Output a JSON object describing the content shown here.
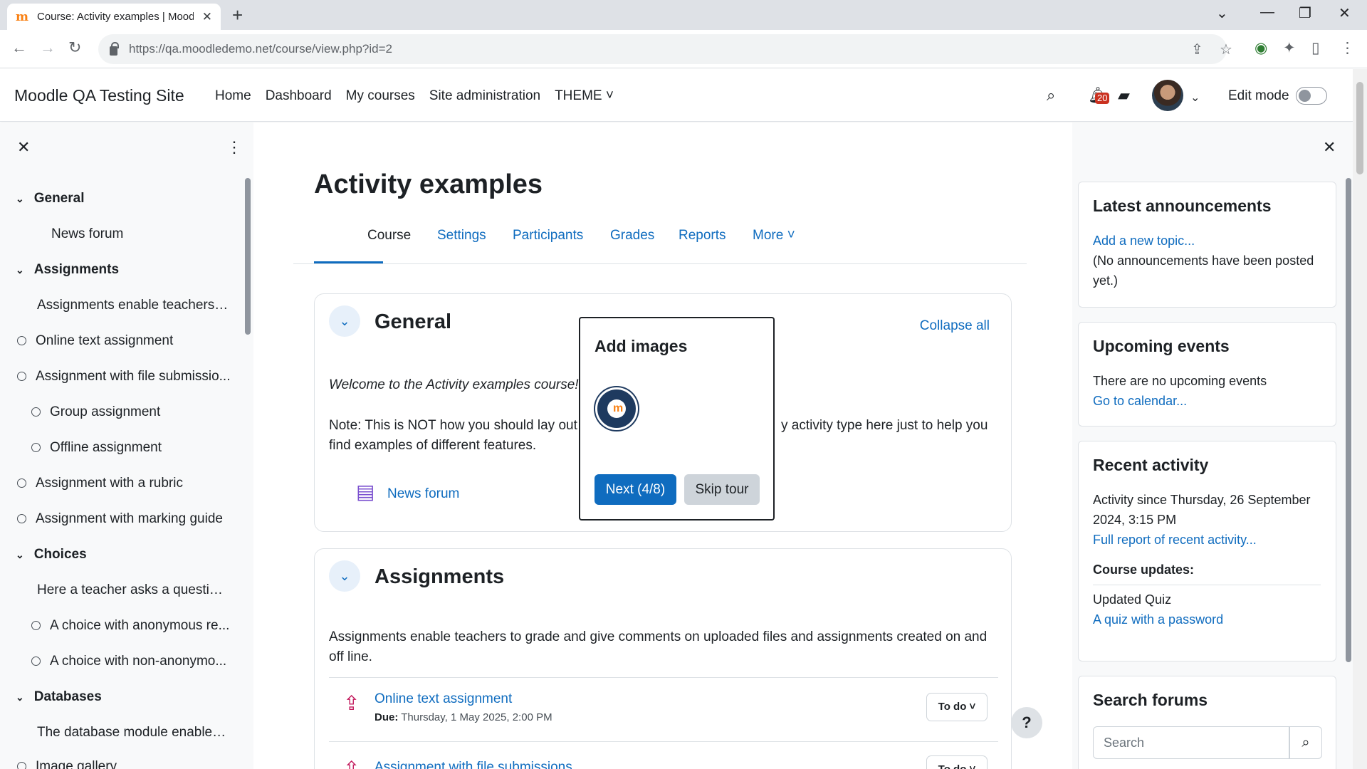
{
  "browser": {
    "tab_title": "Course: Activity examples | Moodle",
    "url": "https://qa.moodledemo.net/course/view.php?id=2"
  },
  "navbar": {
    "site_name": "Moodle QA Testing Site",
    "links": [
      "Home",
      "Dashboard",
      "My courses",
      "Site administration",
      "THEME ˅"
    ],
    "notification_count": "20",
    "edit_mode_label": "Edit mode"
  },
  "course_index": {
    "items": [
      {
        "label": "General",
        "kind": "section"
      },
      {
        "label": "News forum",
        "kind": "activity"
      },
      {
        "label": "Assignments",
        "kind": "section"
      },
      {
        "label": "Assignments enable teachers t...",
        "kind": "label"
      },
      {
        "label": "Online text assignment",
        "kind": "activity-circle"
      },
      {
        "label": "Assignment with file submissio...",
        "kind": "activity-circle"
      },
      {
        "label": "Group assignment",
        "kind": "activity-circle-indent"
      },
      {
        "label": "Offline assignment",
        "kind": "activity-circle-indent"
      },
      {
        "label": "Assignment with a rubric",
        "kind": "activity-circle"
      },
      {
        "label": "Assignment with marking guide",
        "kind": "activity-circle"
      },
      {
        "label": "Choices",
        "kind": "section"
      },
      {
        "label": "Here a teacher asks a question...",
        "kind": "label"
      },
      {
        "label": "A choice with anonymous re...",
        "kind": "activity-circle-indent"
      },
      {
        "label": "A choice with non-anonymo...",
        "kind": "activity-circle-indent"
      },
      {
        "label": "Databases",
        "kind": "section"
      },
      {
        "label": "The database module enables ...",
        "kind": "label"
      },
      {
        "label": "Image gallery",
        "kind": "activity-circle"
      }
    ]
  },
  "main": {
    "title": "Activity examples",
    "tabs": [
      "Course",
      "Settings",
      "Participants",
      "Grades",
      "Reports",
      "More ˅"
    ],
    "general": {
      "title": "General",
      "collapse_all": "Collapse all",
      "welcome": "Welcome to the Activity examples course!",
      "note_left": "Note: This is NOT how you should lay out a",
      "note_right": "y activity type here just to help you",
      "note_line2": "find examples of different features.",
      "forum_link": "News forum"
    },
    "assignments": {
      "title": "Assignments",
      "summary": "Assignments enable teachers to grade and give comments on uploaded files and assignments created on and off line.",
      "item1_link": "Online text assignment",
      "item1_due_label": "Due:",
      "item1_due": "Thursday, 1 May 2025, 2:00 PM",
      "todo_label": "To do ˅",
      "item2_link": "Assignment with file submissions"
    },
    "help": "?"
  },
  "tour": {
    "title": "Add images",
    "badge_text": "m",
    "next_label": "Next (4/8)",
    "skip_label": "Skip tour"
  },
  "right_drawer": {
    "announcements": {
      "title": "Latest announcements",
      "link": "Add a new topic...",
      "text": "(No announcements have been posted yet.)"
    },
    "events": {
      "title": "Upcoming events",
      "text": "There are no upcoming events",
      "link": "Go to calendar..."
    },
    "recent": {
      "title": "Recent activity",
      "since": "Activity since Thursday, 26 September 2024, 3:15 PM",
      "link": "Full report of recent activity...",
      "updates_heading": "Course updates:",
      "update_text": "Updated Quiz",
      "update_link": "A quiz with a password"
    },
    "search": {
      "title": "Search forums",
      "placeholder": "Search"
    }
  },
  "colors": {
    "brand_blue": "#0f6cbf",
    "badge_red": "#ca3120",
    "drawer_bg": "#f8f9fa"
  }
}
